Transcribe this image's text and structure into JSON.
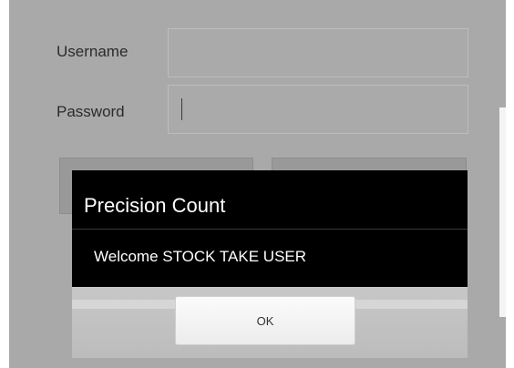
{
  "login": {
    "username_label": "Username",
    "username_value": "",
    "password_label": "Password",
    "password_value": ""
  },
  "dialog": {
    "title": "Precision Count",
    "message": "Welcome STOCK TAKE USER",
    "ok_label": "OK"
  },
  "colors": {
    "dim_background": "#a9a9a9",
    "dialog_background": "#000000",
    "dialog_text": "#ffffff",
    "button_background": "#f3f3f3"
  }
}
